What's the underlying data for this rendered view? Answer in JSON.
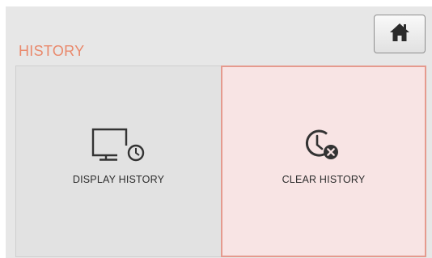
{
  "header": {
    "title": "HISTORY",
    "home_icon": "home-icon"
  },
  "tiles": [
    {
      "label": "DISPLAY HISTORY",
      "icon": "monitor-clock-icon"
    },
    {
      "label": "CLEAR HISTORY",
      "icon": "clock-clear-icon"
    }
  ],
  "colors": {
    "title": "#e9896c",
    "background": "#e7e7e7",
    "tile_default": "#e2e2e2",
    "tile_selected_fill": "#f8e4e4",
    "tile_selected_border": "#e59a8e"
  }
}
